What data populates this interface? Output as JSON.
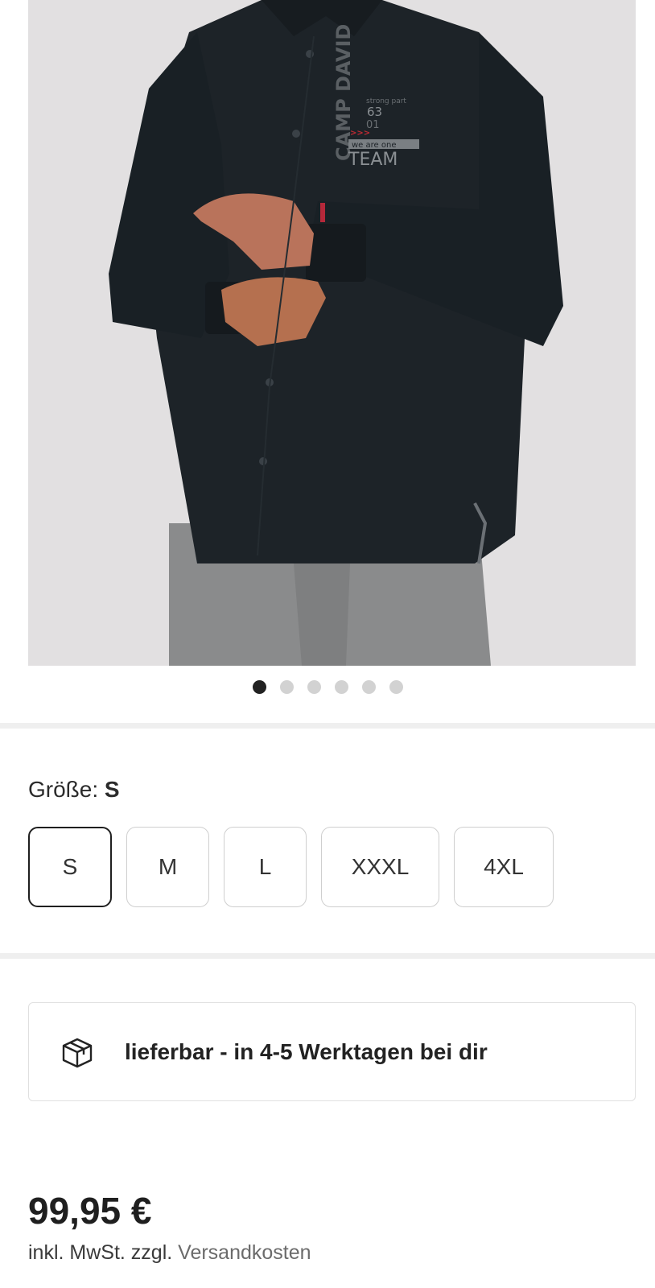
{
  "gallery": {
    "image_alt": "Schwarzes Langarmhemd mit Print",
    "print_text": {
      "brand": "CAMP DAVID",
      "arc": "strong part",
      "number_top": "63",
      "number_bottom": "01",
      "tagline": "we are one",
      "team": "TEAM"
    },
    "dot_count": 6,
    "active_index": 0
  },
  "size_selector": {
    "label": "Größe:",
    "selected": "S",
    "options": [
      "S",
      "M",
      "L",
      "XXXL",
      "4XL"
    ]
  },
  "delivery": {
    "icon": "package-box-icon",
    "text": "lieferbar - in 4-5 Werktagen bei dir"
  },
  "pricing": {
    "price": "99,95 €",
    "tax_note": "inkl. MwSt. zzgl.",
    "shipping_link": "Versandkosten"
  },
  "colors": {
    "shirt": "#1d2328",
    "background_image": "#e2e0e1",
    "dot_active": "#222222",
    "dot_inactive": "#d2d2d2",
    "divider": "#efefef"
  }
}
